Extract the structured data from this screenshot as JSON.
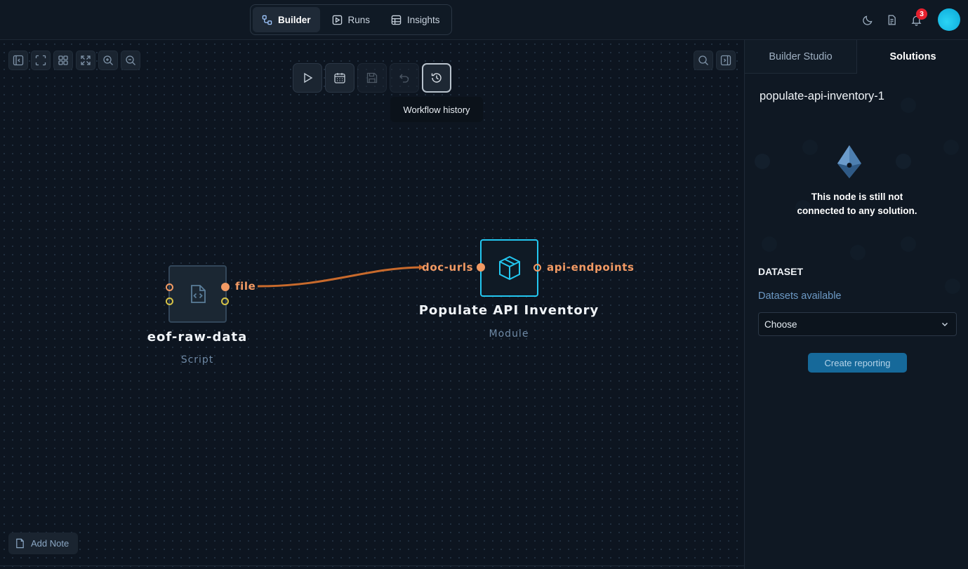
{
  "nav": {
    "tabs": [
      {
        "label": "Builder",
        "icon": "workflow-icon",
        "active": true
      },
      {
        "label": "Runs",
        "icon": "play-square-icon",
        "active": false
      },
      {
        "label": "Insights",
        "icon": "table-icon",
        "active": false
      }
    ]
  },
  "header": {
    "notification_count": "3",
    "icons": [
      "moon-icon",
      "document-icon",
      "bell-icon",
      "avatar"
    ]
  },
  "canvas": {
    "toolbar_left": [
      "collapse-sidebar-icon",
      "fit-view-icon",
      "grid-layout-icon",
      "expand-icon",
      "zoom-in-icon",
      "zoom-out-icon"
    ],
    "toolbar_right": [
      "search-icon",
      "toggle-panel-icon"
    ],
    "actions": [
      "play-icon",
      "calendar-icon",
      "save-icon",
      "undo-icon",
      "history-icon"
    ],
    "tooltip": "Workflow history",
    "add_note_label": "Add Note",
    "nodes": [
      {
        "title": "eof-raw-data",
        "type": "Script",
        "output_port": "file"
      },
      {
        "title": "Populate API Inventory",
        "type": "Module",
        "input_port": "doc-urls",
        "output_port": "api-endpoints"
      }
    ]
  },
  "panel": {
    "tabs": [
      "Builder Studio",
      "Solutions"
    ],
    "active_tab": "Solutions",
    "title": "populate-api-inventory-1",
    "empty_line1": "This node is still not",
    "empty_line2": "connected to any solution.",
    "dataset_heading": "DATASET",
    "datasets_label": "Datasets available",
    "select_value": "Choose",
    "create_button": "Create reporting"
  },
  "colors": {
    "accent_orange": "#f29a64",
    "accent_cyan": "#23c7f0",
    "edge": "#c86a2c",
    "primary_button": "#16699a"
  }
}
